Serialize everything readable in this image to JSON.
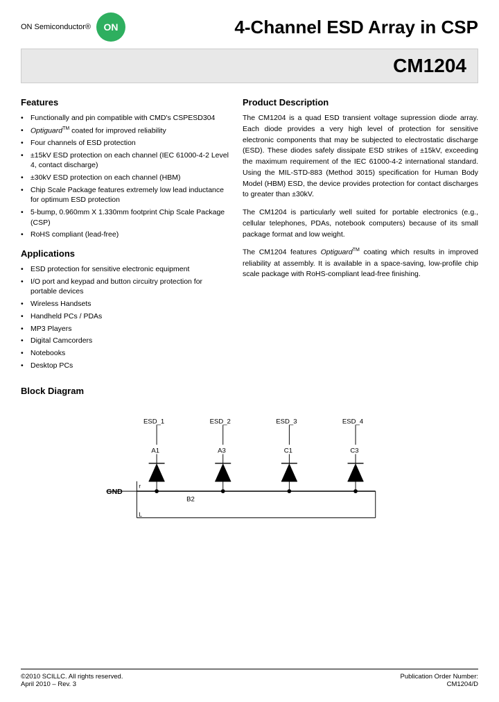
{
  "header": {
    "company": "ON Semiconductor®",
    "logo_text": "ON",
    "title": "4-Channel ESD Array in CSP",
    "part_number": "CM1204"
  },
  "features": {
    "title": "Features",
    "items": [
      "Functionally and pin compatible with CMD's CSPESD304",
      "Optiguard™ coated for improved reliability",
      "Four channels of ESD protection",
      "±15kV ESD protection on each channel (IEC 61000-4-2 Level 4, contact discharge)",
      "±30kV ESD protection on each channel (HBM)",
      "Chip Scale Package features extremely low lead inductance for optimum ESD protection",
      "5-bump, 0.960mm X 1.330mm footprint Chip Scale Package (CSP)",
      "RoHS compliant (lead-free)"
    ]
  },
  "applications": {
    "title": "Applications",
    "items": [
      "ESD protection for sensitive electronic equipment",
      "I/O port and keypad and button circuitry protection for portable devices",
      "Wireless Handsets",
      "Handheld PCs / PDAs",
      "MP3 Players",
      "Digital Camcorders",
      "Notebooks",
      "Desktop PCs"
    ]
  },
  "product_description": {
    "title": "Product Description",
    "paragraphs": [
      "The CM1204 is a quad ESD transient voltage supression diode array. Each diode provides a very high level of protection for sensitive electronic components that may be subjected to electrostatic discharge (ESD). These diodes safely dissipate ESD strikes of ±15kV, exceeding the maximum requirement of the IEC 61000-4-2 international standard. Using the MIL-STD-883 (Method 3015) specification for Human Body Model (HBM) ESD, the device provides protection for contact discharges to greater than ±30kV.",
      "The CM1204 is particularly well suited for portable electronics (e.g., cellular telephones, PDAs, notebook computers) because of its small package format and low weight.",
      "The CM1204 features Optiguard™ coating which results in improved reliability at assembly. It is available in a space-saving, low-profile chip scale package with RoHS-compliant lead-free finishing."
    ]
  },
  "block_diagram": {
    "title": "Block Diagram",
    "nodes": {
      "ESD_1": "ESD_1",
      "ESD_2": "ESD_2",
      "ESD_3": "ESD_3",
      "ESD_4": "ESD_4",
      "A1": "A1",
      "A3": "A3",
      "C1": "C1",
      "C3": "C3",
      "B2": "B2",
      "GND": "GND"
    }
  },
  "footer": {
    "copyright": "©2010 SCILLC.  All rights reserved.",
    "date": "April 2010 – Rev. 3",
    "pub_label": "Publication Order Number:",
    "pub_number": "CM1204/D"
  }
}
